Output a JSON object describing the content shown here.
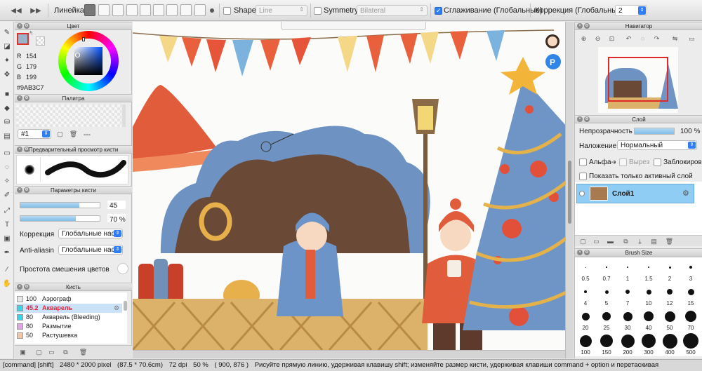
{
  "toolbar": {
    "ruler_label": "Линейка",
    "shape_label": "Shape",
    "shape_value": "Line",
    "symmetry_label": "Symmetry",
    "symmetry_value": "Bilateral",
    "smoothing_label": "Сглаживание (Глобальные)",
    "smoothing_checked": true,
    "correction_label": "Коррекция (Глобальные)",
    "correction_value": "2"
  },
  "color_panel": {
    "title": "Цвет",
    "r_label": "R",
    "r_value": "154",
    "g_label": "G",
    "g_value": "179",
    "b_label": "B",
    "b_value": "199",
    "hex": "#9AB3C7",
    "current_color": "#9AB3C7"
  },
  "palette_panel": {
    "title": "Палитра",
    "palette_name": "#1",
    "palette_extra": "---"
  },
  "brush_preview_panel": {
    "title": "Предварительный просмотр кисти"
  },
  "brush_params": {
    "title": "Параметры кисти",
    "size_value": "45",
    "size_fraction": 0.74,
    "opacity_value": "70 %",
    "opacity_fraction": 0.7,
    "correction_label": "Коррекция",
    "correction_value": "Глобальные настр",
    "antialias_label": "Anti-aliasin",
    "antialias_value": "Глобальные настр",
    "blend_label": "Простота смешения цветов"
  },
  "brush_panel": {
    "title": "Кисть",
    "items": [
      {
        "value": "100",
        "name": "Аэрограф",
        "color": "#e8e8e8",
        "selected": false
      },
      {
        "value": "45.2",
        "name": "Акварель",
        "color": "#34d6e8",
        "selected": true
      },
      {
        "value": "80",
        "name": "Акварель (Bleeding)",
        "color": "#34d6e8",
        "selected": false
      },
      {
        "value": "80",
        "name": "Размытие",
        "color": "#e5a4e8",
        "selected": false
      },
      {
        "value": "50",
        "name": "Растушевка",
        "color": "#f3c7a0",
        "selected": false
      }
    ]
  },
  "navigator": {
    "title": "Навигатор"
  },
  "layers": {
    "title": "Слой",
    "opacity_label": "Непрозрачность",
    "opacity_value": "100 %",
    "blend_label": "Наложение",
    "blend_value": "Нормальный",
    "alpha_label": "Альфа-канал",
    "clip_label": "Вырез",
    "lock_label": "Заблокировать",
    "show_active_label": "Показать только активный слой",
    "layer_name": "Слой1"
  },
  "brush_size": {
    "title": "Brush Size",
    "sizes": [
      "0.5",
      "0.7",
      "1",
      "1.5",
      "2",
      "3",
      "4",
      "5",
      "7",
      "10",
      "12",
      "15",
      "20",
      "25",
      "30",
      "40",
      "50",
      "70",
      "100",
      "150",
      "200",
      "300",
      "400",
      "500"
    ]
  },
  "status": {
    "modifiers": "[command] [shift]",
    "pixels": "2480 * 2000 pixel",
    "cm": "(87.5 * 70.6cm)",
    "dpi": "72 dpi",
    "zoom": "50 %",
    "coords": "( 900, 876 )",
    "hint": "Рисуйте прямую линию, удерживая клавишу shift; изменяйте размер кисти, удерживая клавиши command + option и перетаскивая"
  }
}
